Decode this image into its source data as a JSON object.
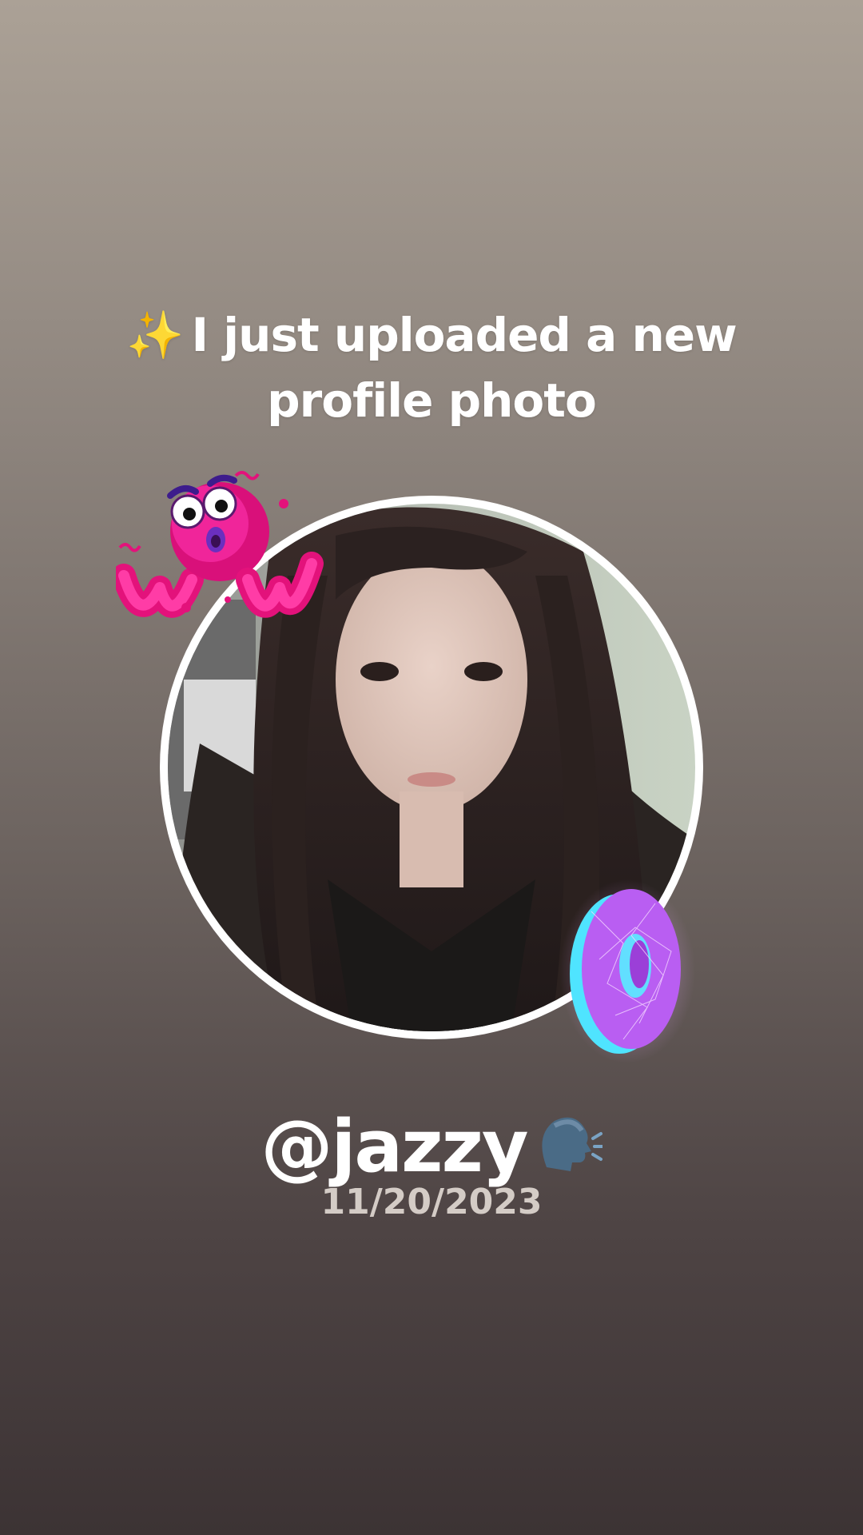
{
  "story": {
    "headline_emoji": "✨",
    "headline_text": "I just uploaded a new profile photo",
    "handle": "@jazzy",
    "handle_emoji_icon": "speaking-head-icon",
    "date": "11/20/2023",
    "stickers": {
      "top_left": "wow-sticker",
      "bottom_right": "donut-sticker"
    }
  }
}
